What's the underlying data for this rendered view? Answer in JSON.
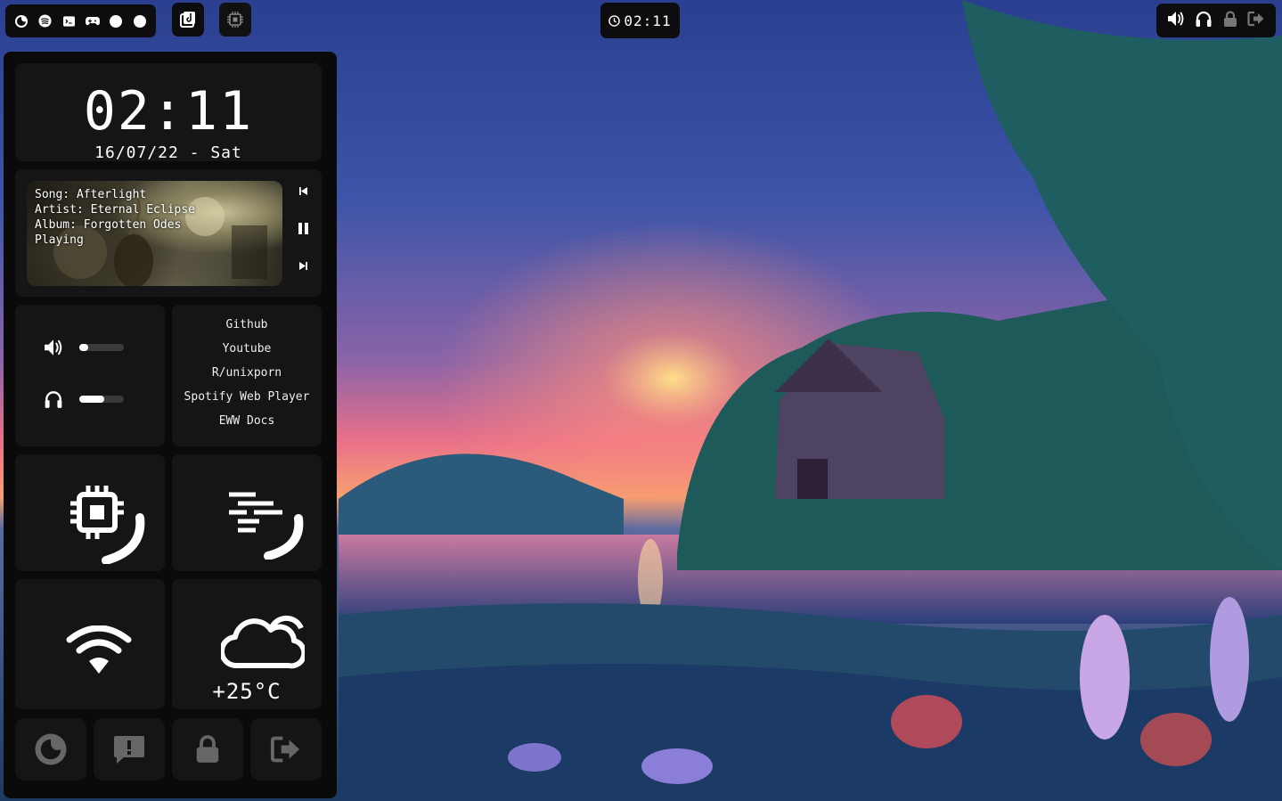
{
  "topbar": {
    "workspaces": [
      {
        "icon": "firefox-icon"
      },
      {
        "icon": "spotify-icon"
      },
      {
        "icon": "terminal-icon"
      },
      {
        "icon": "gamepad-icon"
      },
      {
        "icon": "circle-icon"
      },
      {
        "icon": "circle-icon"
      }
    ],
    "music_icon": "music-note-icon",
    "cpu_icon": "cpu-chip-icon",
    "clock": "02:11",
    "system_icons": [
      "volume-icon",
      "headphones-icon",
      "lock-icon",
      "logout-icon"
    ]
  },
  "sidebar": {
    "time": "02:11",
    "date": "16/07/22 - Sat",
    "music": {
      "song_line": "Song: Afterlight",
      "artist_line": "Artist: Eternal Eclipse",
      "album_line": "Album: Forgotten Odes",
      "status": "Playing"
    },
    "audio": {
      "speaker_volume": 0.2,
      "headphone_volume": 0.55
    },
    "links": [
      "Github",
      "Youtube",
      "R/unixporn",
      "Spotify Web Player",
      "EWW Docs"
    ],
    "weather": {
      "temperature": "+25°C",
      "icon": "cloud-icon"
    },
    "bottom_buttons": [
      "firefox-icon",
      "alert-message-icon",
      "lock-icon",
      "logout-icon"
    ]
  },
  "colors": {
    "panel_bg": "#0a0a0b",
    "card_bg": "#151517",
    "accent": "#ffffff"
  }
}
